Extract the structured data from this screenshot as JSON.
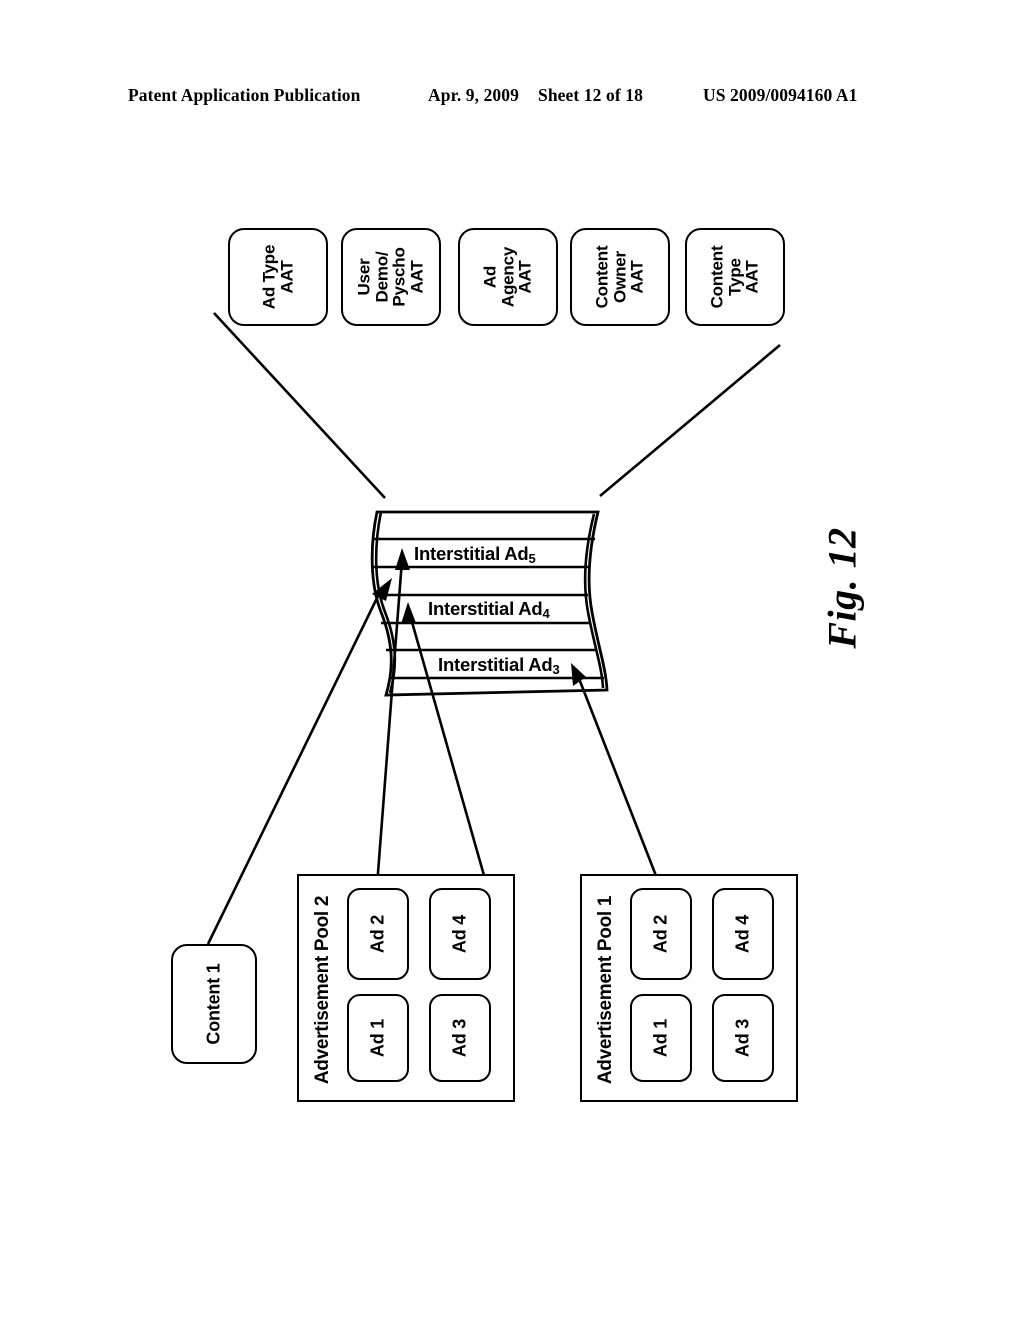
{
  "header": {
    "publication": "Patent Application Publication",
    "date": "Apr. 9, 2009",
    "sheet": "Sheet 12 of 18",
    "patent_number": "US 2009/0094160 A1"
  },
  "figure": {
    "caption": "Fig. 12",
    "aat_boxes": [
      {
        "label": "Ad Type\nAAT"
      },
      {
        "label": "User\nDemo/\nPyscho\nAAT"
      },
      {
        "label": "Ad\nAgency\nAAT"
      },
      {
        "label": "Content\nOwner\nAAT"
      },
      {
        "label": "Content\nType\nAAT"
      }
    ],
    "stack": {
      "items": [
        {
          "label": "Interstitial Ad",
          "subscript": "5"
        },
        {
          "label": "Interstitial Ad",
          "subscript": "4"
        },
        {
          "label": "Interstitial Ad",
          "subscript": "3"
        }
      ]
    },
    "content": {
      "label": "Content 1"
    },
    "pools": [
      {
        "title": "Advertisement Pool 2",
        "ads": [
          {
            "label": "Ad 1"
          },
          {
            "label": "Ad 2"
          },
          {
            "label": "Ad 3"
          },
          {
            "label": "Ad 4"
          }
        ]
      },
      {
        "title": "Advertisement Pool 1",
        "ads": [
          {
            "label": "Ad 1"
          },
          {
            "label": "Ad 2"
          },
          {
            "label": "Ad 3"
          },
          {
            "label": "Ad 4"
          }
        ]
      }
    ]
  },
  "colors": {
    "ink": "#000000",
    "paper": "#ffffff"
  }
}
